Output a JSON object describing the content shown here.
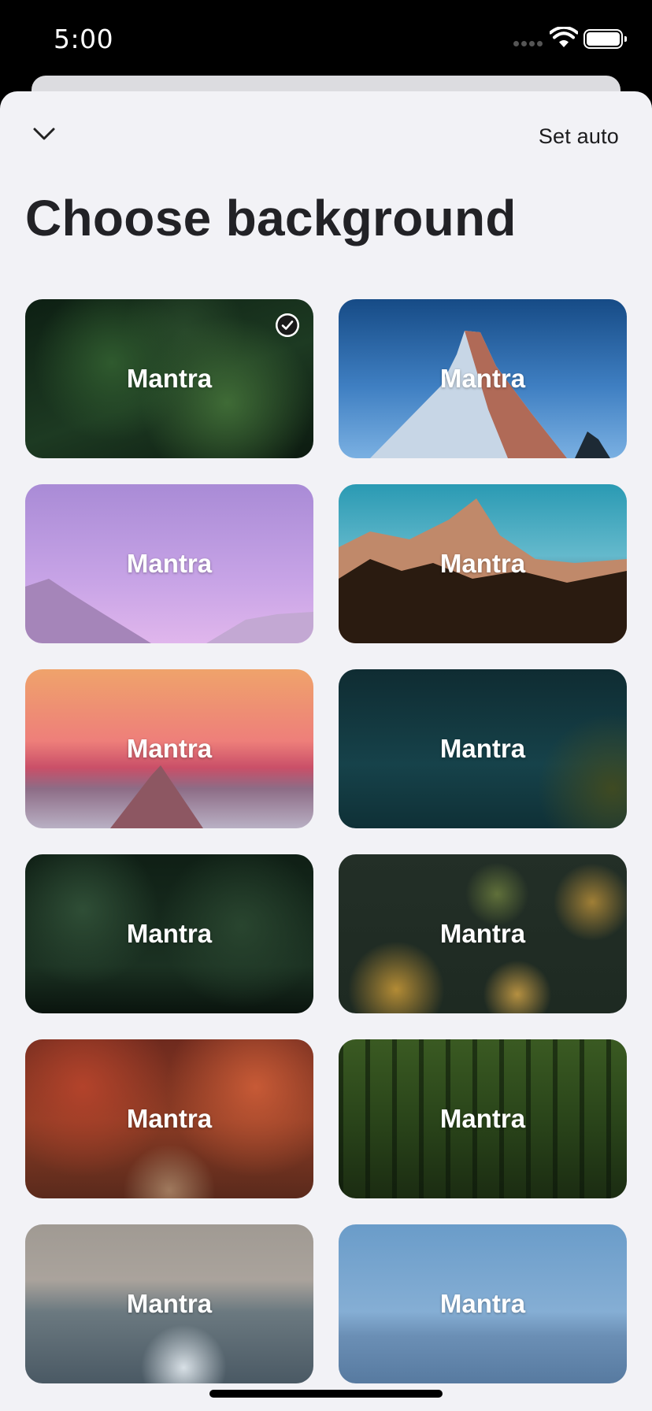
{
  "status_bar": {
    "time": "5:00"
  },
  "header": {
    "set_auto_label": "Set auto",
    "title": "Choose background"
  },
  "backgrounds": [
    {
      "label": "Mantra",
      "scene": "fern-leaves",
      "selected": true
    },
    {
      "label": "Mantra",
      "scene": "snowy-peak-blue-sky",
      "selected": false
    },
    {
      "label": "Mantra",
      "scene": "lavender-sky-mountains",
      "selected": false
    },
    {
      "label": "Mantra",
      "scene": "matterhorn-forest",
      "selected": false
    },
    {
      "label": "Mantra",
      "scene": "sunset-peak-clouds",
      "selected": false
    },
    {
      "label": "Mantra",
      "scene": "dark-teal-water",
      "selected": false
    },
    {
      "label": "Mantra",
      "scene": "forest-lake",
      "selected": false
    },
    {
      "label": "Mantra",
      "scene": "pine-forest",
      "selected": false
    },
    {
      "label": "Mantra",
      "scene": "autumn-path",
      "selected": false
    },
    {
      "label": "Mantra",
      "scene": "green-forest-trail",
      "selected": false
    },
    {
      "label": "Mantra",
      "scene": "ocean-waves",
      "selected": false
    },
    {
      "label": "Mantra",
      "scene": "blue-sky-sea",
      "selected": false
    }
  ]
}
